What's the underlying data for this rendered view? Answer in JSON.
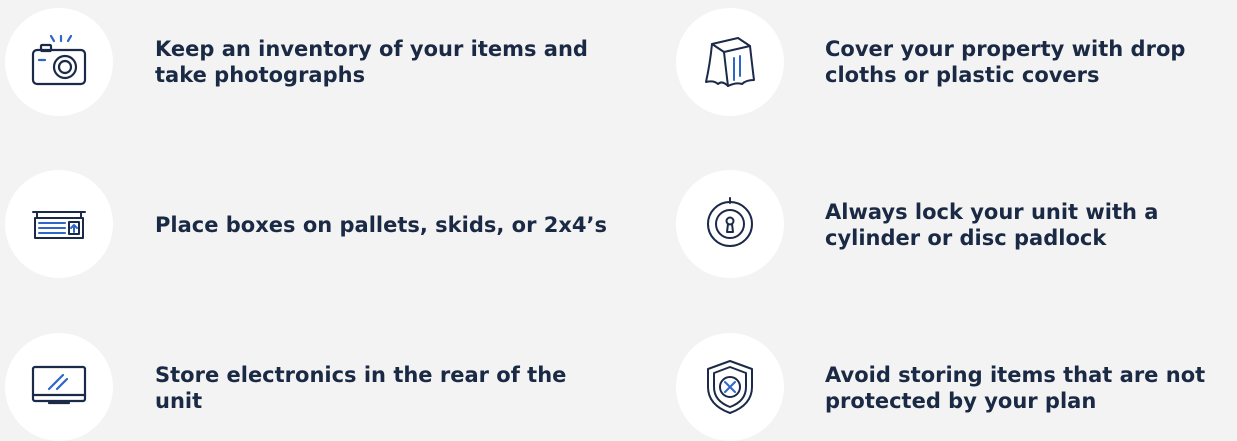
{
  "tips": [
    {
      "text": "Keep an inventory of your items and take photographs",
      "icon": "camera-icon"
    },
    {
      "text": "Cover your property with drop cloths or plastic covers",
      "icon": "drop-cloth-icon"
    },
    {
      "text": "Place boxes on pallets, skids, or 2x4’s",
      "icon": "pallet-icon"
    },
    {
      "text": "Always lock your unit with a cylinder or disc padlock",
      "icon": "padlock-icon"
    },
    {
      "text": "Store electronics in the rear of the unit",
      "icon": "monitor-icon"
    },
    {
      "text": "Avoid storing items that are not protected by your plan",
      "icon": "shield-x-icon"
    }
  ],
  "colors": {
    "background": "#f3f3f3",
    "text": "#1a2a44",
    "icon_navy": "#1c2a4a",
    "icon_blue": "#2f66c9"
  }
}
